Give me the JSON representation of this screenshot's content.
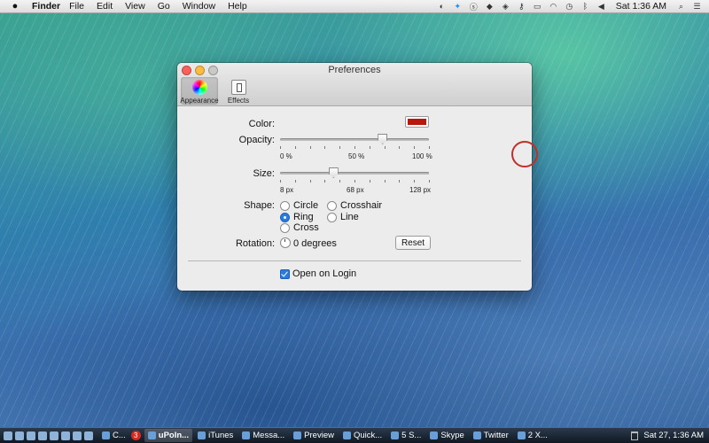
{
  "menubar": {
    "app_name": "Finder",
    "items": [
      "File",
      "Edit",
      "View",
      "Go",
      "Window",
      "Help"
    ],
    "clock": "Sat 1:36 AM",
    "status_icons": [
      "sync-icon",
      "twitter-icon",
      "skype-icon",
      "evernote-icon",
      "dropbox-icon",
      "key-icon",
      "keyboard-icon",
      "wifi-icon",
      "time-machine-icon",
      "bluetooth-icon",
      "volume-icon"
    ]
  },
  "window": {
    "title": "Preferences",
    "toolbar": {
      "appearance": "Appearance",
      "effects": "Effects"
    },
    "color_label": "Color:",
    "color_value": "#b8170b",
    "opacity": {
      "label": "Opacity:",
      "min": "0 %",
      "mid": "50 %",
      "max": "100 %",
      "value_fraction": 0.68
    },
    "size": {
      "label": "Size:",
      "min": "8 px",
      "mid": "68 px",
      "max": "128 px",
      "value_fraction": 0.35
    },
    "shape": {
      "label": "Shape:",
      "options": [
        "Circle",
        "Crosshair",
        "Ring",
        "Line",
        "Cross"
      ],
      "selected": "Ring"
    },
    "rotation": {
      "label": "Rotation:",
      "value": "0 degrees",
      "reset": "Reset"
    },
    "open_on_login": "Open on Login"
  },
  "taskbar": {
    "tasks": [
      {
        "label": "C...",
        "active": false
      },
      {
        "label": "uPoIn...",
        "active": true
      },
      {
        "label": "iTunes",
        "active": false
      },
      {
        "label": "Messa...",
        "active": false
      },
      {
        "label": "Preview",
        "active": false
      },
      {
        "label": "Quick...",
        "active": false
      },
      {
        "label": "5 S...",
        "active": false
      },
      {
        "label": "Skype",
        "active": false
      },
      {
        "label": "Twitter",
        "active": false
      },
      {
        "label": "2 X...",
        "active": false
      }
    ],
    "badge_count": "3",
    "clock": "Sat 27, 1:36 AM"
  },
  "colors": {
    "accent": "#2a7be0",
    "cursor_ring": "#c0302a"
  }
}
